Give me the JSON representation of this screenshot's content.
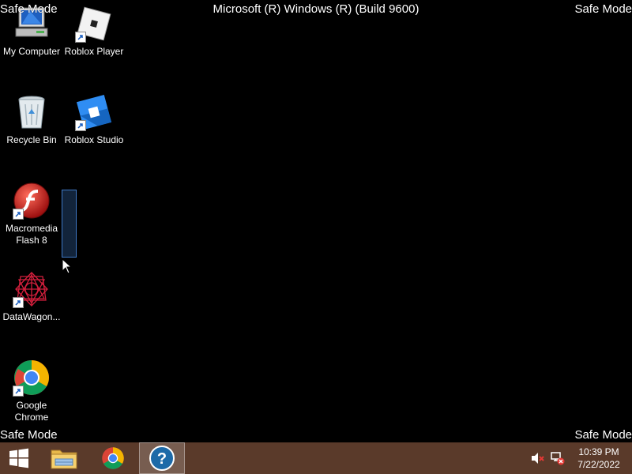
{
  "overlay": {
    "safe_mode_top_left": "Safe Mode",
    "safe_mode_top_right": "Safe Mode",
    "safe_mode_bottom_left": "Safe Mode",
    "safe_mode_bottom_right": "Safe Mode",
    "build_title": "Microsoft (R) Windows (R) (Build 9600)"
  },
  "desktop_icons": [
    {
      "label": "My Computer",
      "icon": "my-computer-icon",
      "shortcut": false
    },
    {
      "label": "Roblox Player",
      "icon": "roblox-player-icon",
      "shortcut": true
    },
    {
      "label": "Recycle Bin",
      "icon": "recycle-bin-icon",
      "shortcut": false
    },
    {
      "label": "Roblox Studio",
      "icon": "roblox-studio-icon",
      "shortcut": true
    },
    {
      "label": "Macromedia Flash 8",
      "icon": "flash-icon",
      "shortcut": true
    },
    {
      "label": "DataWagon...",
      "icon": "datawagon-icon",
      "shortcut": true
    },
    {
      "label": "Google Chrome",
      "icon": "chrome-icon",
      "shortcut": true
    }
  ],
  "taskbar": {
    "buttons": [
      {
        "name": "start",
        "icon": "windows-logo-icon"
      },
      {
        "name": "file-explorer",
        "icon": "folder-icon"
      },
      {
        "name": "chrome",
        "icon": "chrome-icon"
      },
      {
        "name": "help",
        "icon": "help-icon"
      }
    ],
    "tray_icons": [
      "volume-muted-icon",
      "network-disconnected-icon"
    ],
    "clock": {
      "time": "10:39 PM",
      "date": "7/22/2022"
    }
  },
  "colors": {
    "desktop_background": "#000000",
    "taskbar_background": "#5a3a2a",
    "selection_border": "#3f79c6"
  }
}
